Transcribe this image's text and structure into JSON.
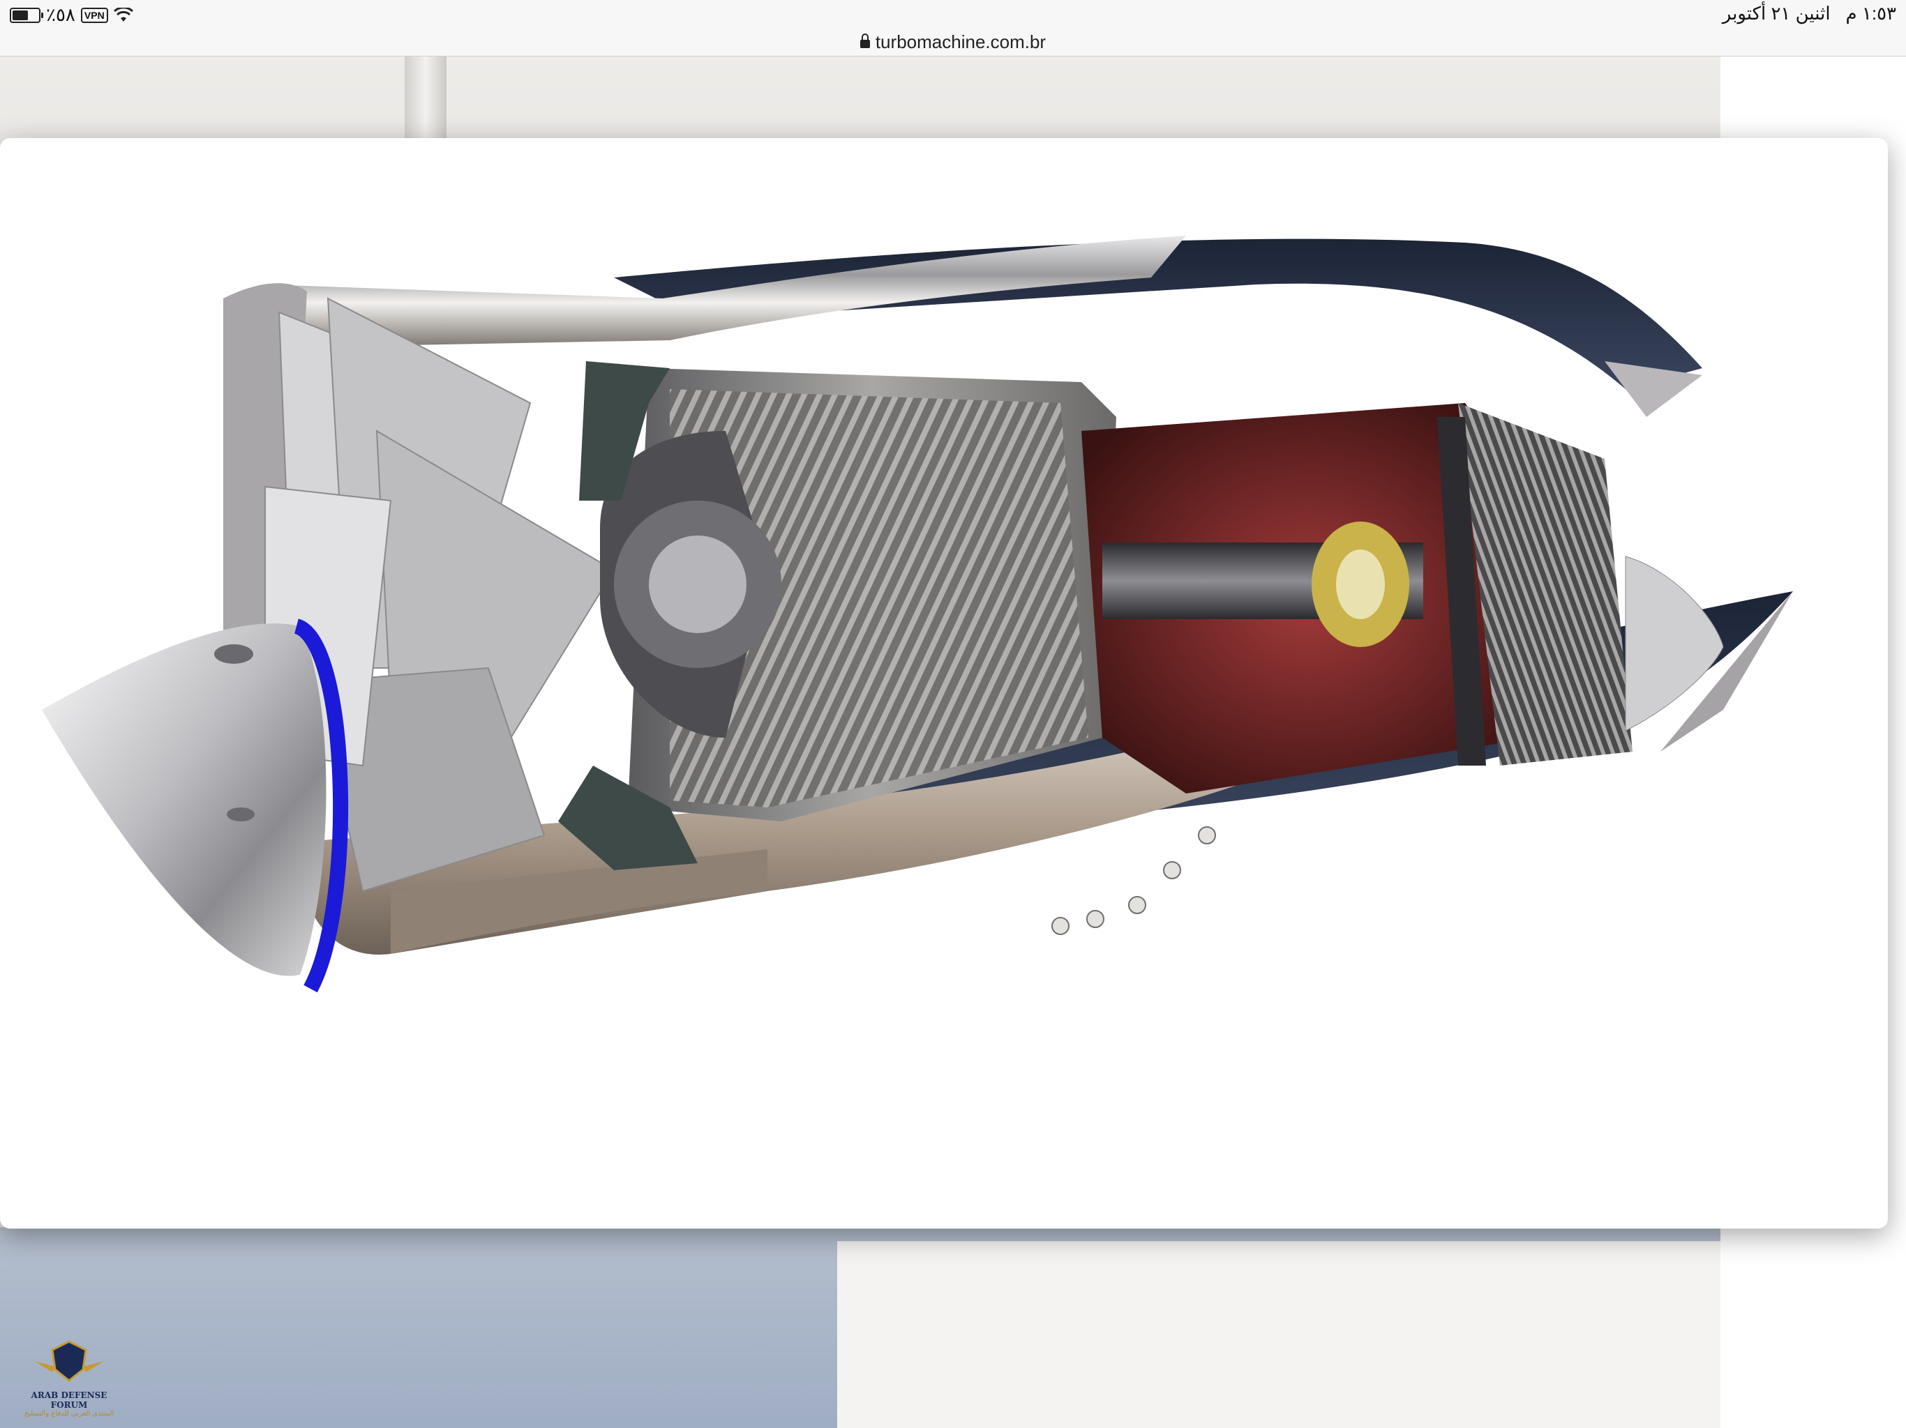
{
  "status_bar": {
    "battery_percent": "٪٥٨",
    "battery_level": 0.58,
    "vpn_label": "VPN",
    "time": "١:٥٣ م",
    "date": "اثنين ٢١ أكتوبر"
  },
  "browser": {
    "url": "turbomachine.com.br"
  },
  "watermark": {
    "title": "ARAB DEFENSE FORUM",
    "subtitle": "المنتدى العربي للدفاع والتسليح"
  },
  "colors": {
    "accent_ring": "#1a1ad8",
    "metal": "#c9c9cc",
    "combustor": "#6e1f1f"
  }
}
